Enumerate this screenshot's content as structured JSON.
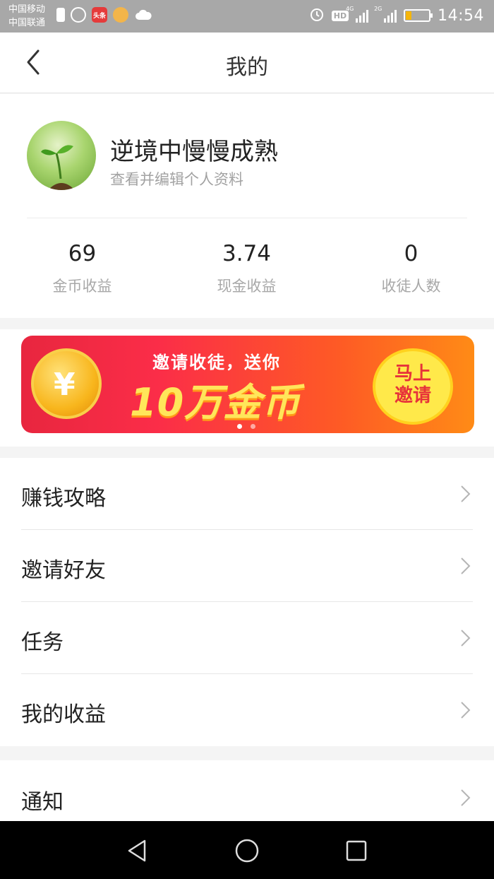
{
  "status_bar": {
    "carrier_1": "中国移动",
    "carrier_2": "中国联通",
    "notif_badge": "头条",
    "hd_label": "HD",
    "net_1": "4G",
    "net_2": "2G",
    "time": "14:54",
    "battery_level_percent": 15
  },
  "header": {
    "title": "我的"
  },
  "profile": {
    "username": "逆境中慢慢成熟",
    "subtitle": "查看并编辑个人资料"
  },
  "stats": [
    {
      "value": "69",
      "label": "金币收益"
    },
    {
      "value": "3.74",
      "label": "现金收益"
    },
    {
      "value": "0",
      "label": "收徒人数"
    }
  ],
  "banner": {
    "coin_symbol": "¥",
    "line1": "邀请收徒，送你",
    "line2": "10万金币",
    "button_line1": "马上",
    "button_line2": "邀请",
    "slide_count": 2,
    "active_slide": 1
  },
  "menu": [
    {
      "label": "赚钱攻略"
    },
    {
      "label": "邀请好友"
    },
    {
      "label": "任务"
    },
    {
      "label": "我的收益"
    }
  ],
  "menu2": [
    {
      "label": "通知"
    }
  ],
  "colors": {
    "status_bar": "#a8a8a8",
    "banner_start": "#e8263f",
    "banner_end": "#ff8b16",
    "invite_button": "#ffe94a",
    "navbar": "#000000"
  }
}
